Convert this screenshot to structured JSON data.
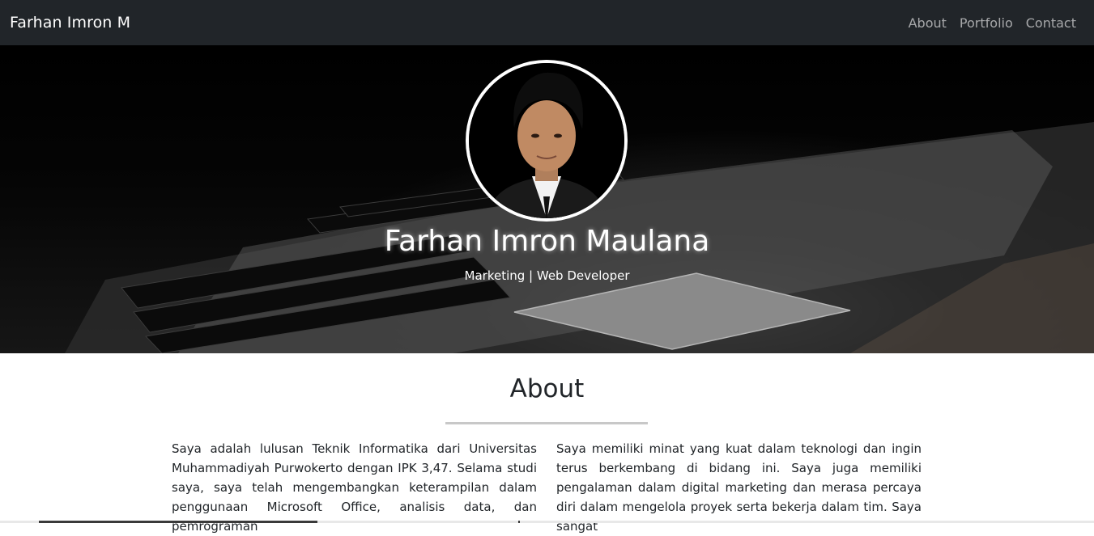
{
  "navbar": {
    "brand": "Farhan Imron M",
    "links": [
      "About",
      "Portfolio",
      "Contact"
    ]
  },
  "hero": {
    "name": "Farhan Imron Maulana",
    "role": "Marketing | Web Developer"
  },
  "about": {
    "title": "About",
    "left_paragraph": "Saya adalah lulusan Teknik Informatika dari Universitas Muhammadiyah Purwokerto dengan IPK 3,47. Selama studi saya, saya telah mengembangkan keterampilan dalam penggunaan Microsoft Office, analisis data, dan pemrograman",
    "right_paragraph": "Saya memiliki minat yang kuat dalam teknologi dan ingin terus berkembang di bidang ini. Saya juga memiliki pengalaman dalam digital marketing dan merasa percaya diri dalam mengelola proyek serta bekerja dalam tim. Saya sangat"
  },
  "colors": {
    "navbar_bg": "#212529",
    "nav_link": "rgba(255,255,255,0.6)",
    "hero_text": "#ffffff",
    "divider": "#c8c8c8"
  },
  "icons": {
    "avatar": "profile-photo"
  }
}
